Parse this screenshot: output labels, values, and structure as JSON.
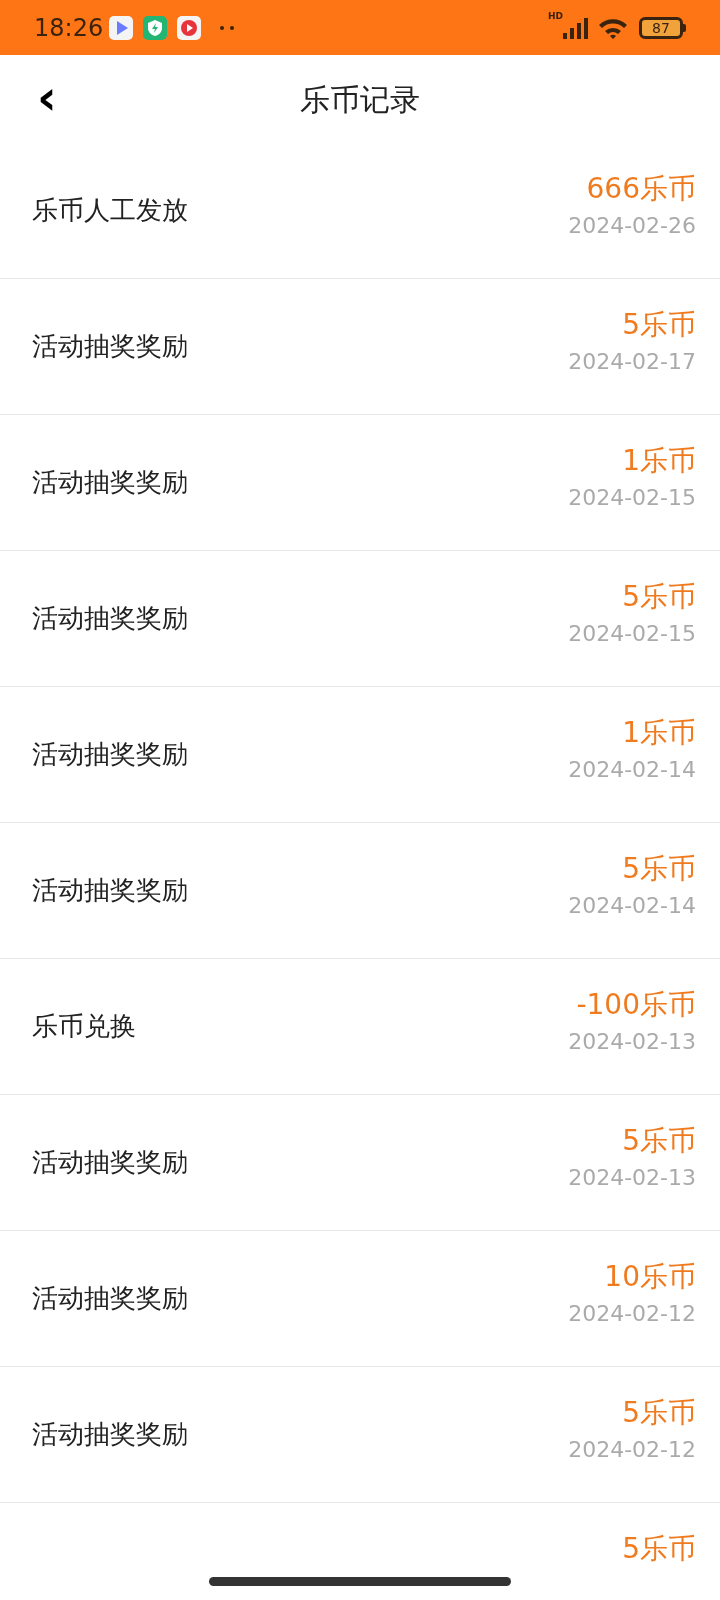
{
  "status_bar": {
    "time": "18:26",
    "network": "HD",
    "battery": "87"
  },
  "header": {
    "back": "‹",
    "title": "乐币记录"
  },
  "records": [
    {
      "title": "乐币人工发放",
      "amount": "666乐币",
      "date": "2024-02-26"
    },
    {
      "title": "活动抽奖奖励",
      "amount": "5乐币",
      "date": "2024-02-17"
    },
    {
      "title": "活动抽奖奖励",
      "amount": "1乐币",
      "date": "2024-02-15"
    },
    {
      "title": "活动抽奖奖励",
      "amount": "5乐币",
      "date": "2024-02-15"
    },
    {
      "title": "活动抽奖奖励",
      "amount": "1乐币",
      "date": "2024-02-14"
    },
    {
      "title": "活动抽奖奖励",
      "amount": "5乐币",
      "date": "2024-02-14"
    },
    {
      "title": "乐币兑换",
      "amount": "-100乐币",
      "date": "2024-02-13"
    },
    {
      "title": "活动抽奖奖励",
      "amount": "5乐币",
      "date": "2024-02-13"
    },
    {
      "title": "活动抽奖奖励",
      "amount": "10乐币",
      "date": "2024-02-12"
    },
    {
      "title": "活动抽奖奖励",
      "amount": "5乐币",
      "date": "2024-02-12"
    },
    {
      "amount": "5乐币"
    }
  ]
}
